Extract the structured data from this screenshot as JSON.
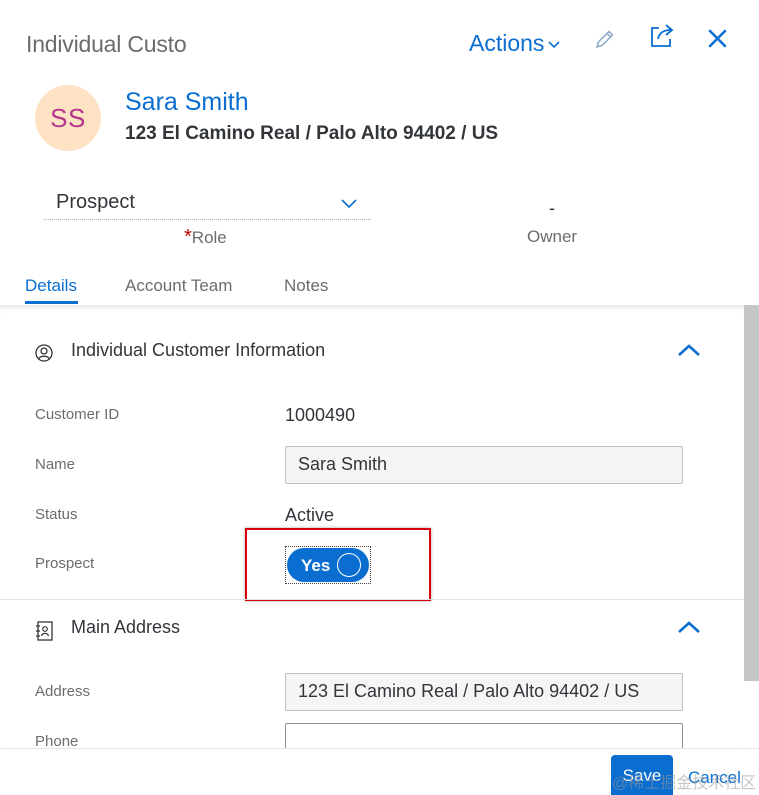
{
  "header": {
    "title": "Individual Custo",
    "actions_label": "Actions",
    "icons": [
      "pencil-icon",
      "share-icon",
      "close-icon"
    ]
  },
  "customer": {
    "initials": "SS",
    "name": "Sara Smith",
    "address": "123 El Camino Real / Palo Alto 94402 / US"
  },
  "role": {
    "value": "Prospect",
    "required_mark": "*",
    "label": "Role"
  },
  "owner": {
    "value": "-",
    "label": "Owner"
  },
  "tabs": [
    {
      "label": "Details",
      "active": true
    },
    {
      "label": "Account Team",
      "active": false
    },
    {
      "label": "Notes",
      "active": false
    }
  ],
  "sections": {
    "customer_info": {
      "title": "Individual Customer Information",
      "fields": {
        "customer_id_label": "Customer ID",
        "customer_id_value": "1000490",
        "name_label": "Name",
        "name_value": "Sara Smith",
        "status_label": "Status",
        "status_value": "Active",
        "prospect_label": "Prospect",
        "prospect_toggle": "Yes"
      }
    },
    "main_address": {
      "title": "Main Address",
      "fields": {
        "address_label": "Address",
        "address_value": "123 El Camino Real / Palo Alto 94402 / US",
        "phone_label": "Phone",
        "phone_value": ""
      }
    }
  },
  "footer": {
    "save_label": "Save",
    "cancel_label": "Cancel",
    "watermark": "@稀土掘金技术社区"
  },
  "colors": {
    "accent": "#0a6ed1",
    "avatar_bg": "#fde2c4",
    "avatar_text": "#b3358c",
    "required": "#bb0000",
    "highlight": "#d8000c"
  }
}
